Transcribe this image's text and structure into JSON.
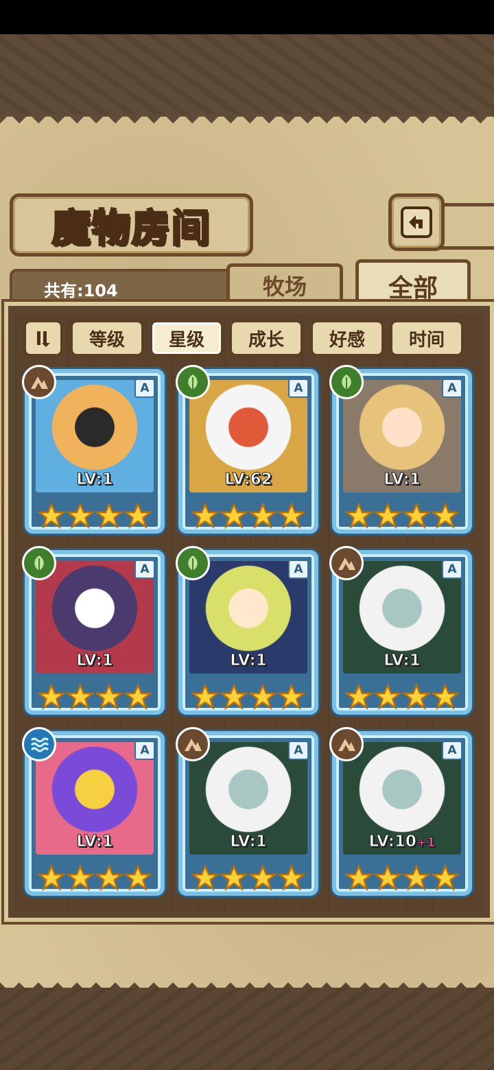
{
  "header": {
    "title": "魔物房间",
    "back_icon": "back-arrow-icon"
  },
  "summary": {
    "count_label": "共有:104"
  },
  "tabs": [
    {
      "label": "牧场",
      "active": false
    },
    {
      "label": "全部",
      "active": true
    }
  ],
  "filters": {
    "sort_icon": "sort-toggle-icon",
    "buttons": [
      {
        "label": "等级",
        "active": false
      },
      {
        "label": "星级",
        "active": true
      },
      {
        "label": "成长",
        "active": false
      },
      {
        "label": "好感",
        "active": false
      },
      {
        "label": "时间",
        "active": false
      }
    ]
  },
  "monsters": [
    {
      "level": "LV:1",
      "plus": "",
      "attribute": "earth",
      "rank": "A",
      "stars": 4,
      "palette": [
        "#f0b25a",
        "#2a2a2a",
        "#5fb0e0"
      ]
    },
    {
      "level": "LV:62",
      "plus": "",
      "attribute": "wood",
      "rank": "A",
      "stars": 4,
      "palette": [
        "#f5f5f5",
        "#e05a3a",
        "#d9a646"
      ]
    },
    {
      "level": "LV:1",
      "plus": "",
      "attribute": "wood",
      "rank": "A",
      "stars": 4,
      "palette": [
        "#e6c27a",
        "#ffe0c8",
        "#8a7a6a"
      ]
    },
    {
      "level": "LV:1",
      "plus": "",
      "attribute": "wood",
      "rank": "A",
      "stars": 4,
      "palette": [
        "#4a3a6e",
        "#ffffff",
        "#b33a4a"
      ]
    },
    {
      "level": "LV:1",
      "plus": "",
      "attribute": "wood",
      "rank": "A",
      "stars": 4,
      "palette": [
        "#d8e06a",
        "#ffe8cc",
        "#2a3a6a"
      ]
    },
    {
      "level": "LV:1",
      "plus": "",
      "attribute": "earth",
      "rank": "A",
      "stars": 4,
      "palette": [
        "#f2f2f2",
        "#a8c6c2",
        "#2a4a3a"
      ]
    },
    {
      "level": "LV:1",
      "plus": "",
      "attribute": "water",
      "rank": "A",
      "stars": 4,
      "palette": [
        "#7a4ad8",
        "#f6d040",
        "#e86a8a"
      ]
    },
    {
      "level": "LV:1",
      "plus": "",
      "attribute": "earth",
      "rank": "A",
      "stars": 4,
      "palette": [
        "#f2f2f2",
        "#a8c6c2",
        "#2a4a3a"
      ]
    },
    {
      "level": "LV:10",
      "plus": "+1",
      "attribute": "earth",
      "rank": "A",
      "stars": 4,
      "palette": [
        "#f2f2f2",
        "#a8c6c2",
        "#2a4a3a"
      ]
    }
  ]
}
